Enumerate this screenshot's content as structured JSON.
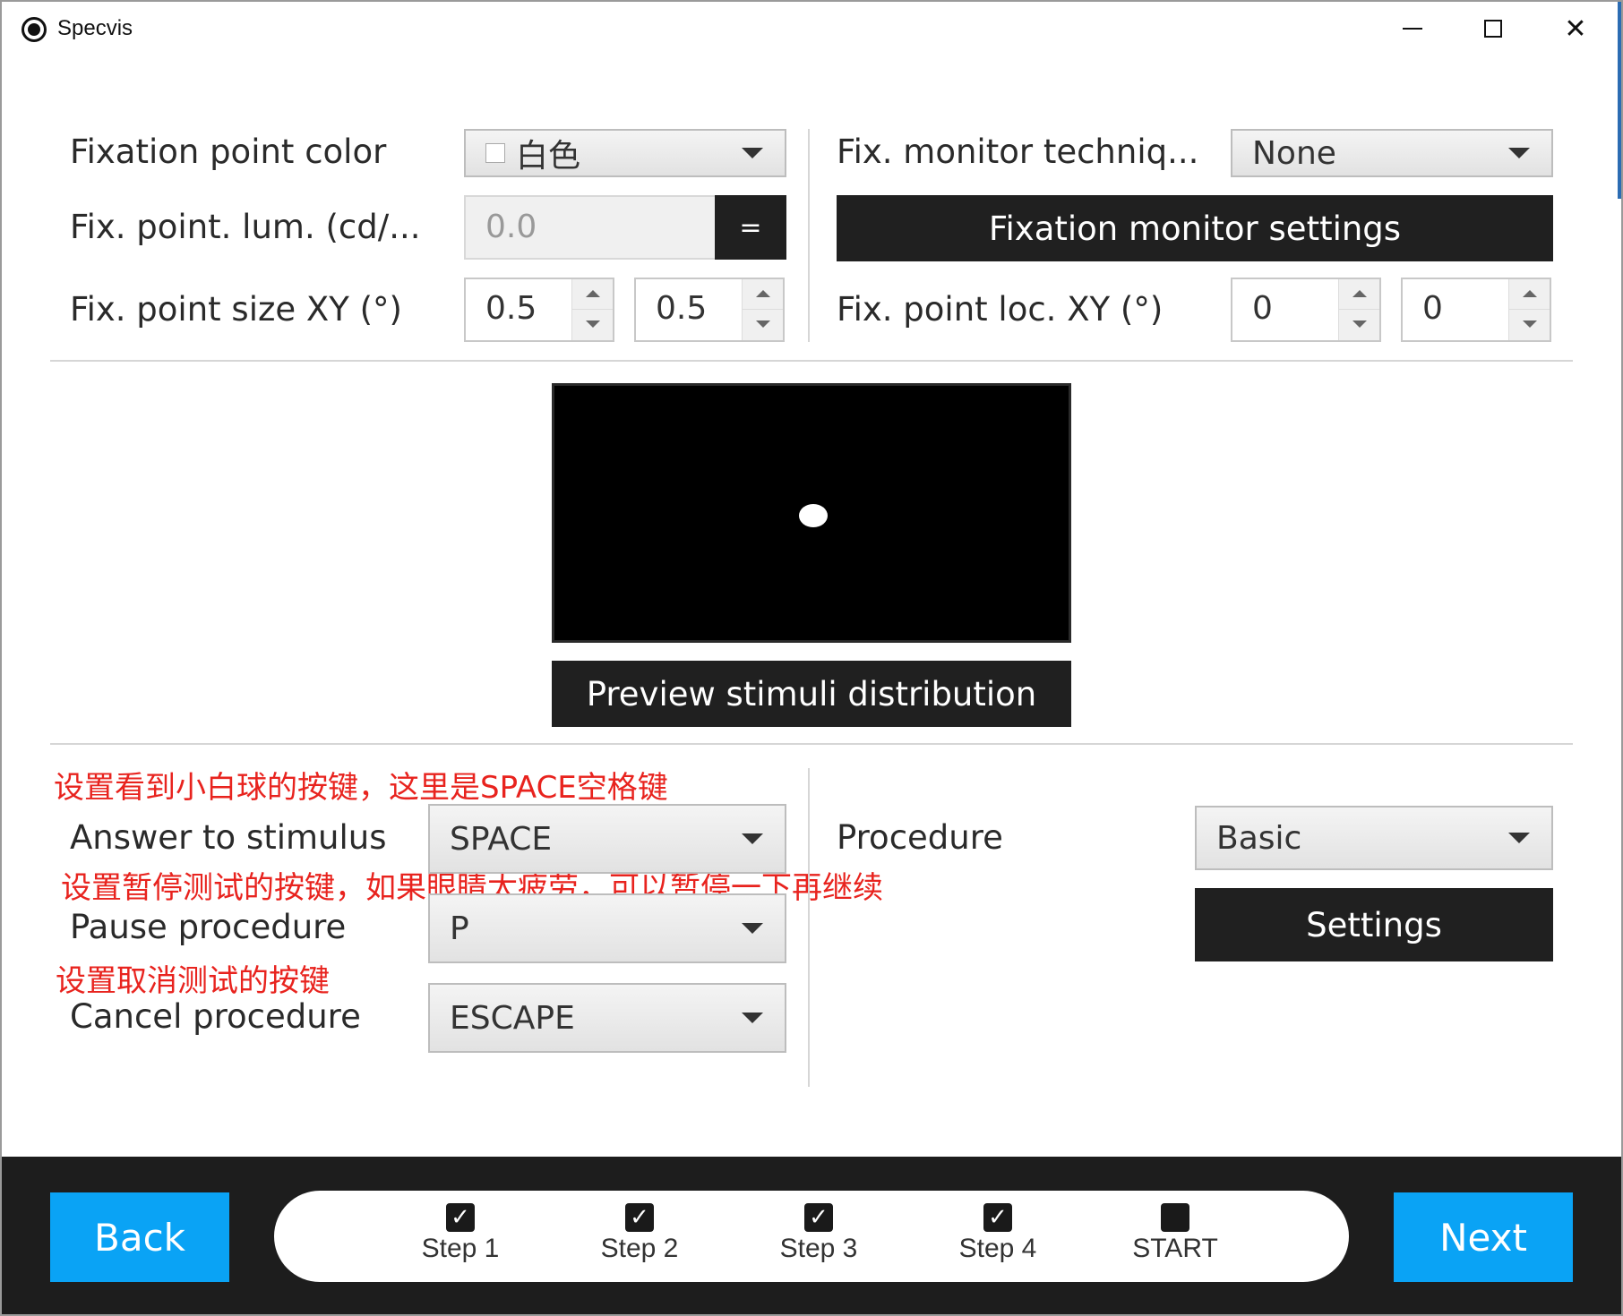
{
  "window": {
    "title": "Specvis",
    "minimize_icon": "minimize-icon",
    "maximize_icon": "maximize-icon",
    "close_icon": "close-icon",
    "close_glyph": "✕"
  },
  "fixation": {
    "color_label": "Fixation point color",
    "color_value": "白色",
    "lum_label": "Fix. point. lum. (cd/...",
    "lum_value": "0.0",
    "lum_button": "=",
    "size_label": "Fix. point size XY (°)",
    "size_x": "0.5",
    "size_y": "0.5",
    "monitor_label": "Fix. monitor techniq...",
    "monitor_value": "None",
    "monitor_settings_button": "Fixation monitor settings",
    "loc_label": "Fix. point loc. XY (°)",
    "loc_x": "0",
    "loc_y": "0"
  },
  "preview": {
    "button": "Preview stimuli distribution"
  },
  "annotations": {
    "answer": "设置看到小白球的按键，这里是SPACE空格键",
    "pause": "设置暂停测试的按键，如果眼睛太疲劳，可以暂停一下再继续",
    "cancel": "设置取消测试的按键"
  },
  "keys": {
    "answer_label": "Answer to stimulus",
    "answer_value": "SPACE",
    "pause_label": "Pause procedure",
    "pause_value": "P",
    "cancel_label": "Cancel procedure",
    "cancel_value": "ESCAPE"
  },
  "procedure": {
    "label": "Procedure",
    "value": "Basic",
    "settings_button": "Settings"
  },
  "footer": {
    "back": "Back",
    "next": "Next",
    "steps": [
      {
        "label": "Step 1",
        "checked": true,
        "mark": "✓"
      },
      {
        "label": "Step 2",
        "checked": true,
        "mark": "✓"
      },
      {
        "label": "Step 3",
        "checked": true,
        "mark": "✓"
      },
      {
        "label": "Step 4",
        "checked": true,
        "mark": "✓"
      },
      {
        "label": "START",
        "checked": false,
        "mark": ""
      }
    ]
  },
  "colors": {
    "accent_blue": "#0aa3f5",
    "dark_button": "#202020",
    "annotation_red": "#e8231e"
  }
}
